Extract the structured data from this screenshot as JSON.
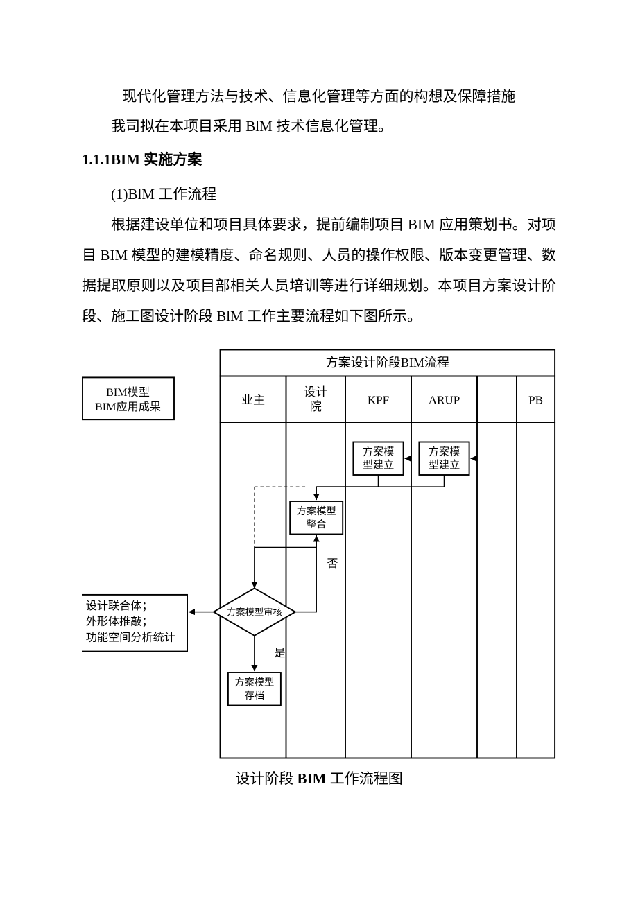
{
  "doc": {
    "title": "现代化管理方法与技术、信息化管理等方面的构想及保障措施",
    "intro": "我司拟在本项目采用 BlM 技术信息化管理。",
    "sectionNumber": "1.1.1BIM 实施方案",
    "sub1": "(1)BlM 工作流程",
    "body1": "根据建设单位和项目具体要求，提前编制项目 BIM 应用策划书。对项目 BIM 模型的建模精度、命名规则、人员的操作权限、版本变更管理、数据提取原则以及项目部相关人员培训等进行详细规划。本项目方案设计阶段、施工图设计阶段 BlM 工作主要流程如下图所示。",
    "caption_prefix": "设计阶段 ",
    "caption_bold": "BIM",
    "caption_suffix": " 工作流程图"
  },
  "diagram": {
    "header": "方案设计阶段BIM流程",
    "leftBox1_l1": "BIM模型",
    "leftBox1_l2": "BIM应用成果",
    "leftBox2_l1": "设计联合体；",
    "leftBox2_l2": "外形体推敲；",
    "leftBox2_l3": "功能空间分析统计",
    "col1": "业主",
    "col2_l1": "设计",
    "col2_l2": "院",
    "col3": "KPF",
    "col4": "ARUP",
    "col5": "PB",
    "box_kpf_l1": "方案模",
    "box_kpf_l2": "型建立",
    "box_arup_l1": "方案模",
    "box_arup_l2": "型建立",
    "box_merge_l1": "方案模型",
    "box_merge_l2": "整合",
    "decision": "方案模型审核",
    "no": "否",
    "yes": "是",
    "box_archive_l1": "方案模型",
    "box_archive_l2": "存档"
  }
}
